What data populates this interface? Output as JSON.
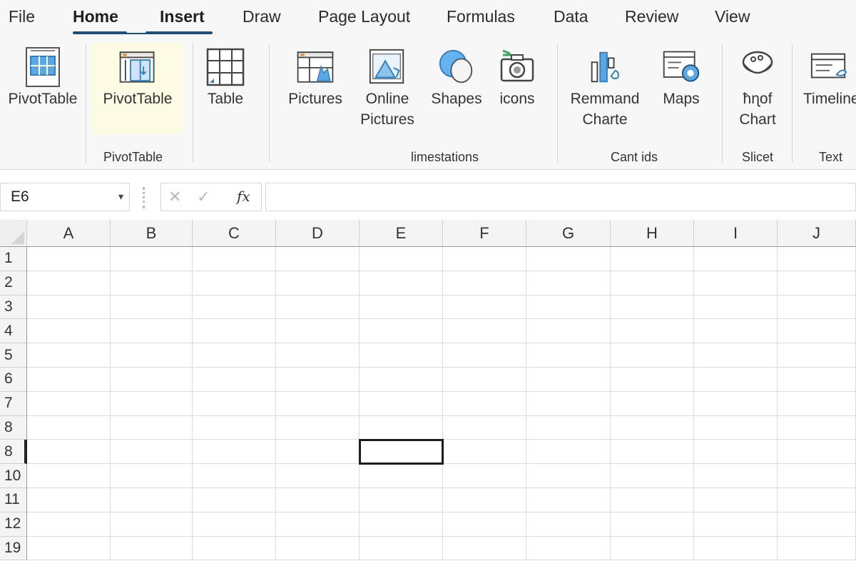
{
  "menu": {
    "tabs": [
      {
        "label": "File",
        "active": false
      },
      {
        "label": "Home",
        "active": true
      },
      {
        "label": "Insert",
        "active": true
      },
      {
        "label": "Draw",
        "active": false
      },
      {
        "label": "Page Layout",
        "active": false
      },
      {
        "label": "Formulas",
        "active": false
      },
      {
        "label": "Data",
        "active": false
      },
      {
        "label": "Review",
        "active": false
      },
      {
        "label": "View",
        "active": false
      }
    ]
  },
  "ribbon": {
    "buttons": {
      "pivottable_1": "PivotTable",
      "pivottable_2": "PivotTable",
      "table": "Table",
      "pictures": "Pictures",
      "online_pictures": "Online\nPictures",
      "shapes": "Shapes",
      "icons": "icons",
      "remmand_charte": "Remmand\nCharte",
      "maps": "Maps",
      "chart": "ħɳof\nChart",
      "timeline": "Timeline"
    },
    "groups": {
      "pivottable": "PivotTable",
      "illustrations": "limestations",
      "charts": "Cant ids",
      "slicer": "Slicet",
      "text": "Text"
    }
  },
  "formula_bar": {
    "name_box": "E6",
    "name_box_caret": "▾",
    "cancel_glyph": "✕",
    "enter_glyph": "✓",
    "fx_glyph": "fx",
    "formula": ""
  },
  "grid": {
    "columns": [
      "A",
      "B",
      "C",
      "D",
      "E",
      "F",
      "G",
      "H",
      "I",
      "J"
    ],
    "rows": [
      "1",
      "2",
      "3",
      "4",
      "5",
      "6",
      "7",
      "8",
      "8",
      "10",
      "11",
      "12",
      "19"
    ],
    "selected_row_index": 8,
    "selected_column": "E"
  },
  "colors": {
    "tab_underline": "#1e4e79",
    "icon_blue": "#2f8fd6",
    "icon_green": "#3aa65a",
    "highlight": "#fcfbe3"
  }
}
